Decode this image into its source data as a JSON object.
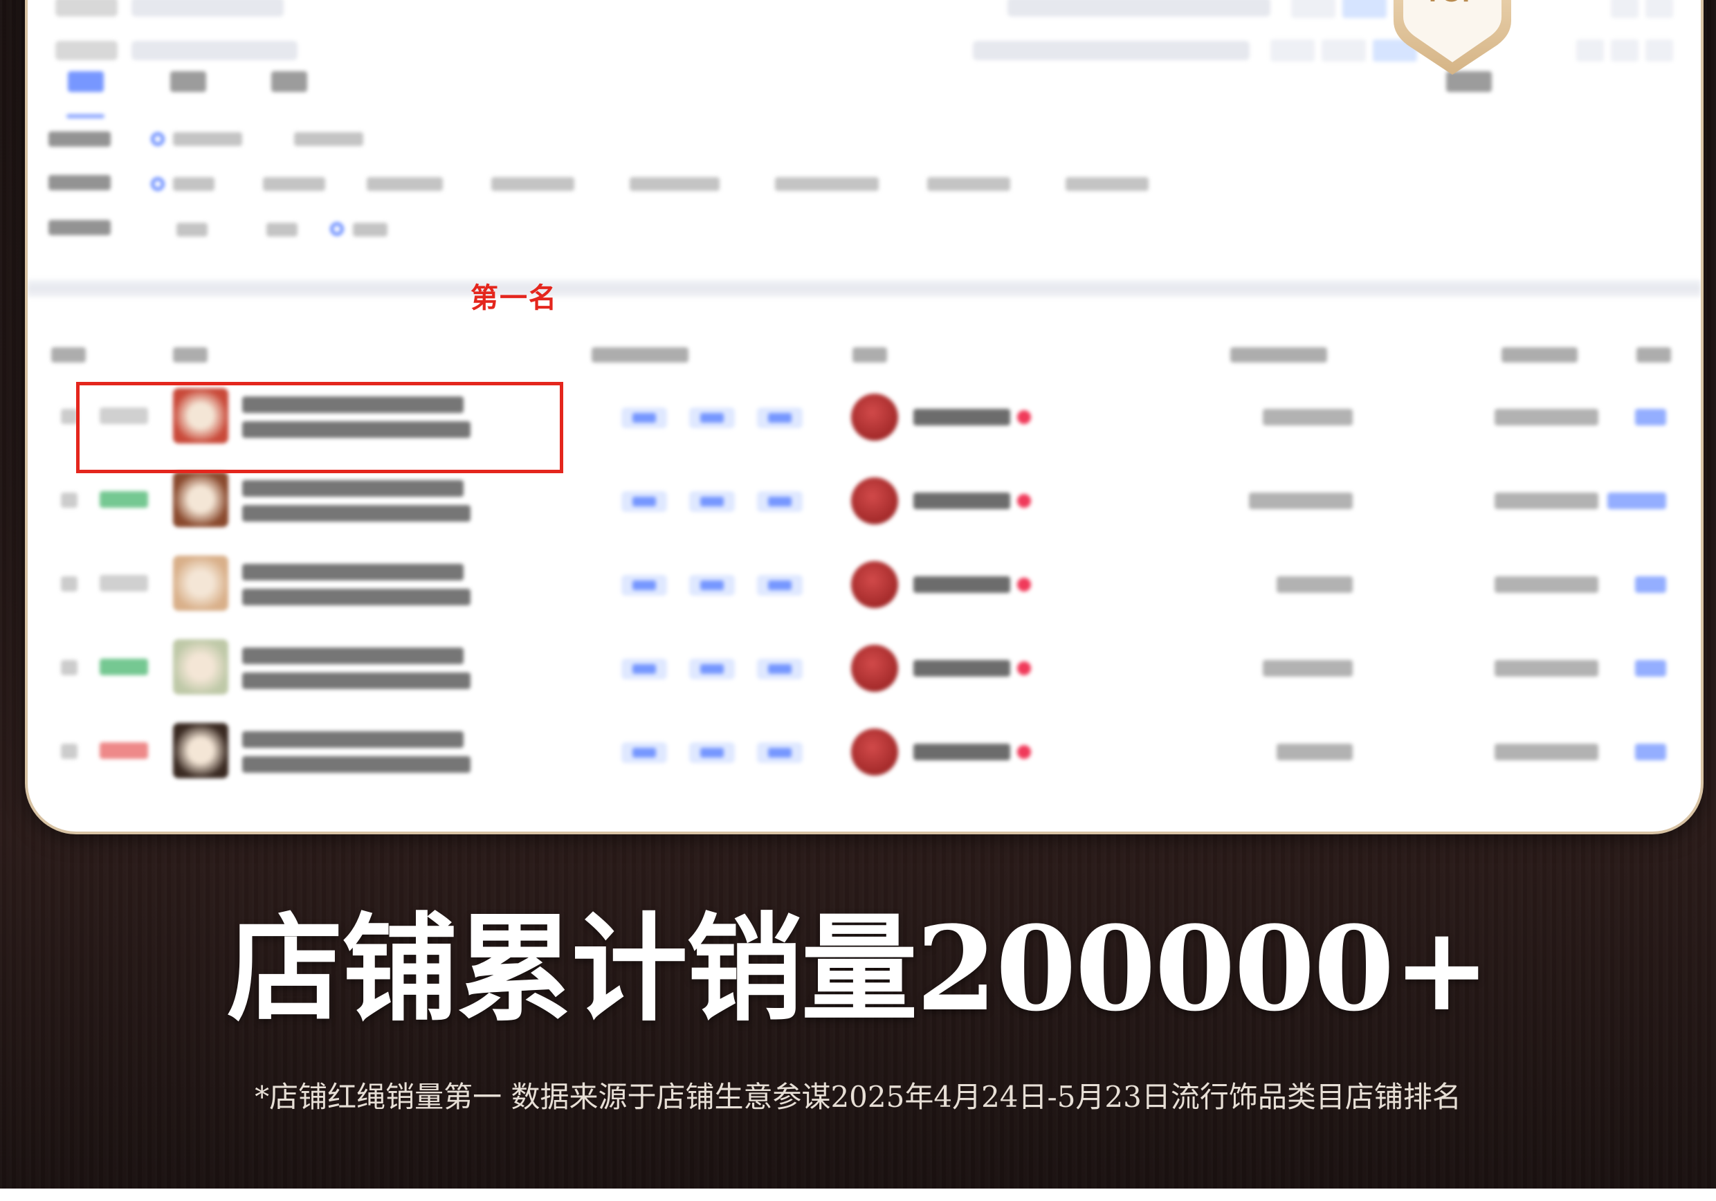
{
  "badge": {
    "label": "TOP"
  },
  "ranking": {
    "highlight_label": "第一名",
    "rows": [
      {
        "tag_color": "#b0b0b0",
        "thumb": "#c94a3a",
        "chips": 3
      },
      {
        "tag_color": "#19a34a",
        "thumb": "#8a4a2e",
        "chips": 3
      },
      {
        "tag_color": "#b0b0b0",
        "thumb": "#d9b08a",
        "chips": 3
      },
      {
        "tag_color": "#19a34a",
        "thumb": "#bfc9a8",
        "chips": 3
      },
      {
        "tag_color": "#e23a3a",
        "thumb": "#3a2a22",
        "chips": 3
      }
    ]
  },
  "headline": {
    "text": "店铺累计销量200000+"
  },
  "footnote": {
    "text": "*店铺红绳销量第一  数据来源于店铺生意参谋2025年4月24日-5月23日流行饰品类目店铺排名"
  },
  "colors": {
    "accent_red": "#e4261d",
    "brand_blue": "#3d6bff",
    "badge_gold": "#d9b886"
  }
}
